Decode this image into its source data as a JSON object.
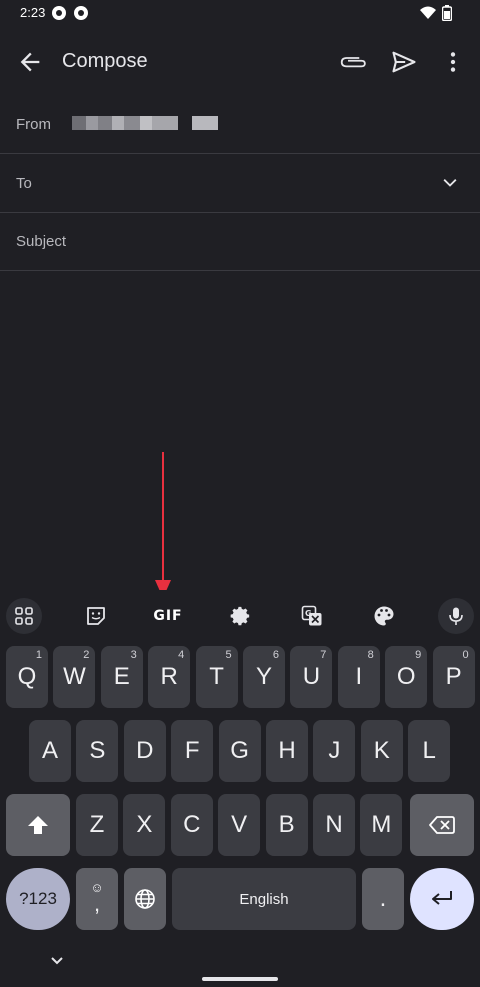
{
  "status_bar": {
    "time": "2:23"
  },
  "app_bar": {
    "title": "Compose"
  },
  "form": {
    "from_label": "From",
    "to_label": "To",
    "subject_placeholder": "Subject"
  },
  "toolbar": {
    "items": [
      "apps-icon",
      "sticker-icon",
      "gif-button",
      "settings-icon",
      "translate-icon",
      "palette-icon",
      "mic-icon"
    ],
    "gif_label": "GIF"
  },
  "keyboard": {
    "row1": [
      {
        "key": "Q",
        "hint": "1"
      },
      {
        "key": "W",
        "hint": "2"
      },
      {
        "key": "E",
        "hint": "3"
      },
      {
        "key": "R",
        "hint": "4"
      },
      {
        "key": "T",
        "hint": "5"
      },
      {
        "key": "Y",
        "hint": "6"
      },
      {
        "key": "U",
        "hint": "7"
      },
      {
        "key": "I",
        "hint": "8"
      },
      {
        "key": "O",
        "hint": "9"
      },
      {
        "key": "P",
        "hint": "0"
      }
    ],
    "row2": [
      "A",
      "S",
      "D",
      "F",
      "G",
      "H",
      "J",
      "K",
      "L"
    ],
    "row3": [
      "Z",
      "X",
      "C",
      "V",
      "B",
      "N",
      "M"
    ],
    "symbols_label": "?123",
    "emoji_top": "☺",
    "comma": ",",
    "space_label": "English",
    "period": "."
  },
  "colors": {
    "background": "#1f1f24",
    "key": "#3b3c42",
    "modifier_key": "#5d5e64",
    "symbols_key": "#aeb1c9",
    "enter_key": "#dfe3ff",
    "annotation_arrow": "#e8303f"
  }
}
